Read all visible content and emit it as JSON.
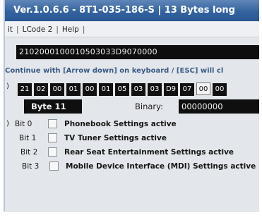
{
  "window": {
    "title": "Ver.1.0.6.6  -  8T1-035-186-S | 13 Bytes long"
  },
  "menu": {
    "items": [
      "it",
      "LCode 2",
      "Help"
    ],
    "separator": "|",
    "trailing_separator": "|"
  },
  "code_field": {
    "value": "2102000100010503033D9070000"
  },
  "hint": {
    "text": "Continue with [Arrow down] on keyboard / [ESC] will cl"
  },
  "byte_row": {
    "marker": ")",
    "bytes": [
      "21",
      "02",
      "00",
      "01",
      "00",
      "01",
      "05",
      "03",
      "03",
      "D9",
      "07",
      "00",
      "00"
    ],
    "selected_index": 11
  },
  "byte_selector": {
    "label": "Byte 11"
  },
  "binary": {
    "label": "Binary:",
    "value": "00000000"
  },
  "bits": {
    "marker": ")",
    "items": [
      {
        "name": "Bit 0",
        "description": "Phonebook Settings active",
        "checked": false
      },
      {
        "name": "Bit 1",
        "description": "TV Tuner Settings active",
        "checked": false
      },
      {
        "name": "Bit 2",
        "description": "Rear Seat Entertainment Settings active",
        "checked": false
      },
      {
        "name": "Bit 3",
        "description": "Mobile Device Interface (MDI) Settings active",
        "checked": false
      }
    ]
  }
}
